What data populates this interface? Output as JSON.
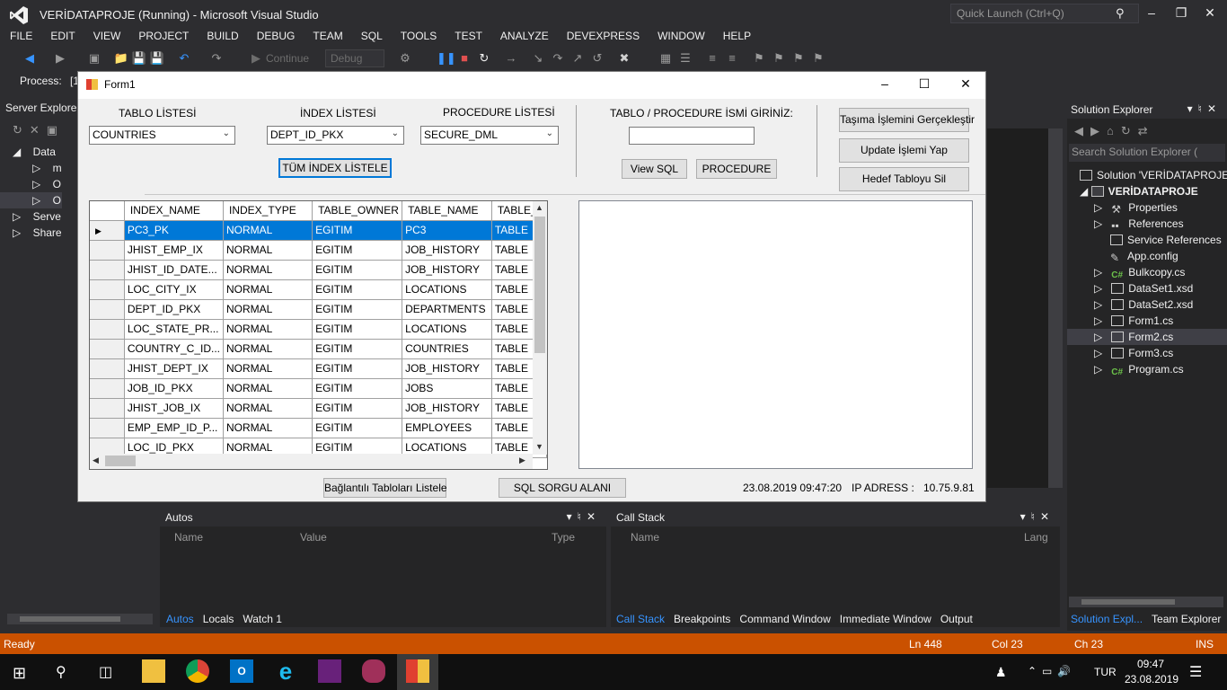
{
  "vs": {
    "title": "VERİDATAPROJE (Running) - Microsoft Visual Studio",
    "quick_launch": "Quick Launch (Ctrl+Q)",
    "menu": [
      "FILE",
      "EDIT",
      "VIEW",
      "PROJECT",
      "BUILD",
      "DEBUG",
      "TEAM",
      "SQL",
      "TOOLS",
      "TEST",
      "ANALYZE",
      "DEVEXPRESS",
      "WINDOW",
      "HELP"
    ],
    "toolbar": {
      "continue": "Continue",
      "config": "Debug",
      "process_label": "Process:",
      "process_value": "[1"
    },
    "server_explorer": {
      "title": "Server Explorer",
      "items": [
        "Data",
        "m",
        "O",
        "O",
        "Serve",
        "Share"
      ]
    }
  },
  "form": {
    "title": "Form1",
    "labels": {
      "tablo": "TABLO LİSTESİ",
      "index": "İNDEX LİSTESİ",
      "procedure": "PROCEDURE LİSTESİ",
      "isim": "TABLO / PROCEDURE İSMİ GİRİNİZ:"
    },
    "combos": {
      "tablo": "COUNTRIES",
      "index": "DEPT_ID_PKX",
      "procedure": "SECURE_DML"
    },
    "buttons": {
      "tum_index": "TÜM İNDEX LİSTELE",
      "view_sql": "View SQL",
      "procedure": "PROCEDURE",
      "tasima": "Taşıma İşlemini Gerçekleştir",
      "update": "Update İşlemi Yap",
      "hedef_sil": "Hedef Tabloyu Sil",
      "baglantili": "Bağlantılı Tabloları Listele",
      "sql_sorgu": "SQL SORGU ALANI"
    },
    "grid": {
      "columns": [
        "INDEX_NAME",
        "INDEX_TYPE",
        "TABLE_OWNER",
        "TABLE_NAME",
        "TABLE_T"
      ],
      "rows": [
        [
          "PC3_PK",
          "NORMAL",
          "EGITIM",
          "PC3",
          "TABLE"
        ],
        [
          "JHIST_EMP_IX",
          "NORMAL",
          "EGITIM",
          "JOB_HISTORY",
          "TABLE"
        ],
        [
          "JHIST_ID_DATE...",
          "NORMAL",
          "EGITIM",
          "JOB_HISTORY",
          "TABLE"
        ],
        [
          "LOC_CITY_IX",
          "NORMAL",
          "EGITIM",
          "LOCATIONS",
          "TABLE"
        ],
        [
          "DEPT_ID_PKX",
          "NORMAL",
          "EGITIM",
          "DEPARTMENTS",
          "TABLE"
        ],
        [
          "LOC_STATE_PR...",
          "NORMAL",
          "EGITIM",
          "LOCATIONS",
          "TABLE"
        ],
        [
          "COUNTRY_C_ID...",
          "NORMAL",
          "EGITIM",
          "COUNTRIES",
          "TABLE"
        ],
        [
          "JHIST_DEPT_IX",
          "NORMAL",
          "EGITIM",
          "JOB_HISTORY",
          "TABLE"
        ],
        [
          "JOB_ID_PKX",
          "NORMAL",
          "EGITIM",
          "JOBS",
          "TABLE"
        ],
        [
          "JHIST_JOB_IX",
          "NORMAL",
          "EGITIM",
          "JOB_HISTORY",
          "TABLE"
        ],
        [
          "EMP_EMP_ID_P...",
          "NORMAL",
          "EGITIM",
          "EMPLOYEES",
          "TABLE"
        ],
        [
          "LOC_ID_PKX",
          "NORMAL",
          "EGITIM",
          "LOCATIONS",
          "TABLE"
        ]
      ]
    },
    "datetime": "23.08.2019 09:47:20",
    "ip_label": "IP ADRESS :",
    "ip_value": "10.75.9.81"
  },
  "autos": {
    "title": "Autos",
    "cols": [
      "Name",
      "Value",
      "Type"
    ],
    "tabs": [
      "Autos",
      "Locals",
      "Watch 1"
    ]
  },
  "callstack": {
    "title": "Call Stack",
    "cols": [
      "Name",
      "Lang"
    ],
    "tabs": [
      "Call Stack",
      "Breakpoints",
      "Command Window",
      "Immediate Window",
      "Output"
    ]
  },
  "solution": {
    "title": "Solution Explorer",
    "search": "Search Solution Explorer (",
    "items": [
      "Solution 'VERİDATAPROJE'",
      "VERİDATAPROJE",
      "Properties",
      "References",
      "Service References",
      "App.config",
      "Bulkcopy.cs",
      "DataSet1.xsd",
      "DataSet2.xsd",
      "Form1.cs",
      "Form2.cs",
      "Form3.cs",
      "Program.cs"
    ],
    "tabs": [
      "Solution Expl...",
      "Team Explorer"
    ]
  },
  "status": {
    "ready": "Ready",
    "ln": "Ln 448",
    "col": "Col 23",
    "ch": "Ch 23",
    "ins": "INS"
  },
  "taskbar": {
    "lang": "TUR",
    "time": "09:47",
    "date": "23.08.2019"
  },
  "colors": {
    "vs_bg": "#2d2d30",
    "status": "#ca5100",
    "accent": "#0078d7",
    "vs_purple": "#68217a"
  }
}
